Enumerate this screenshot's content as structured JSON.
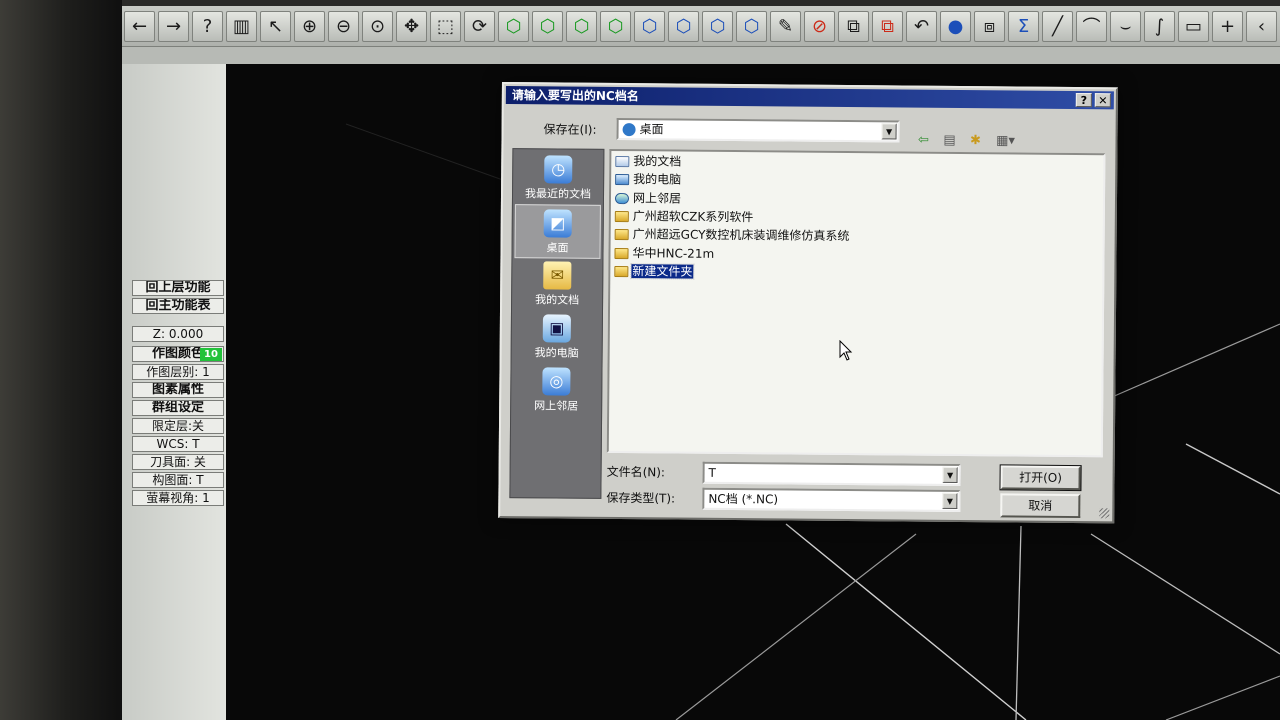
{
  "toolbar": {
    "buttons": [
      {
        "icon": "arrow-left-icon",
        "glyph": "←"
      },
      {
        "icon": "arrow-right-icon",
        "glyph": "→"
      },
      {
        "icon": "help-icon",
        "glyph": "?"
      },
      {
        "icon": "calculator-icon",
        "glyph": "▥"
      },
      {
        "icon": "whats-this-icon",
        "glyph": "↖"
      },
      {
        "icon": "zoom-in-icon",
        "glyph": "⊕"
      },
      {
        "icon": "zoom-out-icon",
        "glyph": "⊖"
      },
      {
        "icon": "zoom-window-icon",
        "glyph": "⊙"
      },
      {
        "icon": "pan-icon",
        "glyph": "✥"
      },
      {
        "icon": "zoom-fit-icon",
        "glyph": "⬚"
      },
      {
        "icon": "rotate-view-icon",
        "glyph": "⟳"
      },
      {
        "icon": "view-top-icon",
        "glyph": "⬡"
      },
      {
        "icon": "view-front-icon",
        "glyph": "⬡"
      },
      {
        "icon": "view-side-icon",
        "glyph": "⬡"
      },
      {
        "icon": "view-iso-icon",
        "glyph": "⬡"
      },
      {
        "icon": "cube-blue-1-icon",
        "glyph": "⬡"
      },
      {
        "icon": "cube-blue-2-icon",
        "glyph": "⬡"
      },
      {
        "icon": "cube-blue-3-icon",
        "glyph": "⬡"
      },
      {
        "icon": "cube-blue-4-icon",
        "glyph": "⬡"
      },
      {
        "icon": "pencil-icon",
        "glyph": "✎"
      },
      {
        "icon": "no-draw-icon",
        "glyph": "⊘"
      },
      {
        "icon": "layout-split-icon",
        "glyph": "⧉"
      },
      {
        "icon": "layout-color-icon",
        "glyph": "⧉"
      },
      {
        "icon": "undo-icon",
        "glyph": "↶"
      },
      {
        "icon": "sphere-icon",
        "glyph": "●"
      },
      {
        "icon": "transform-icon",
        "glyph": "⧈"
      },
      {
        "icon": "sigma-icon",
        "glyph": "Σ"
      },
      {
        "icon": "line-icon",
        "glyph": "╱"
      },
      {
        "icon": "arc-icon",
        "glyph": "⌒"
      },
      {
        "icon": "arc-down-icon",
        "glyph": "⌣"
      },
      {
        "icon": "spline-icon",
        "glyph": "∫"
      },
      {
        "icon": "rectangle-icon",
        "glyph": "▭"
      },
      {
        "icon": "plus-icon",
        "glyph": "+"
      },
      {
        "icon": "more-icon",
        "glyph": "‹"
      }
    ]
  },
  "leftpanel": {
    "items": [
      {
        "label": "回上层功能",
        "bold": true
      },
      {
        "label": "回主功能表",
        "bold": true
      },
      {
        "label": "Z:  0.000",
        "bold": false
      },
      {
        "label": "作图颜色",
        "bold": true,
        "badge": "10"
      },
      {
        "label": "作图层别: 1",
        "bold": false
      },
      {
        "label": "图素属性",
        "bold": true
      },
      {
        "label": "群组设定",
        "bold": true
      },
      {
        "label": "限定层:关",
        "bold": false
      },
      {
        "label": "WCS: T",
        "bold": false
      },
      {
        "label": "刀具面: 关",
        "bold": false
      },
      {
        "label": "构图面: T",
        "bold": false
      },
      {
        "label": "萤幕视角: 1",
        "bold": false
      }
    ]
  },
  "dialog": {
    "title": "请输入要写出的NC档名",
    "help_btn": "?",
    "close_btn": "✕",
    "save_in_label": "保存在(I):",
    "save_in_value": "桌面",
    "places": [
      {
        "label": "我最近的文档",
        "icon": "recent-docs-icon",
        "glyph": "◷",
        "selected": false
      },
      {
        "label": "桌面",
        "icon": "desktop-icon",
        "glyph": "◩",
        "selected": true
      },
      {
        "label": "我的文档",
        "icon": "my-documents-icon",
        "glyph": "✉",
        "selected": false
      },
      {
        "label": "我的电脑",
        "icon": "my-computer-icon",
        "glyph": "▣",
        "selected": false
      },
      {
        "label": "网上邻居",
        "icon": "network-places-icon",
        "glyph": "◎",
        "selected": false
      }
    ],
    "files": [
      {
        "name": "我的文档",
        "type": "doc",
        "selected": false
      },
      {
        "name": "我的电脑",
        "type": "pc",
        "selected": false
      },
      {
        "name": "网上邻居",
        "type": "net",
        "selected": false
      },
      {
        "name": "广州超软CZK系列软件",
        "type": "folder",
        "selected": false
      },
      {
        "name": "广州超远GCY数控机床装调维修仿真系统",
        "type": "folder",
        "selected": false
      },
      {
        "name": "华中HNC-21m",
        "type": "folder",
        "selected": false
      },
      {
        "name": "新建文件夹",
        "type": "folder",
        "selected": true
      }
    ],
    "filename_label": "文件名(N):",
    "filename_value": "T",
    "filetype_label": "保存类型(T):",
    "filetype_value": "NC档 (*.NC)",
    "open_btn": "打开(O)",
    "cancel_btn": "取消"
  }
}
